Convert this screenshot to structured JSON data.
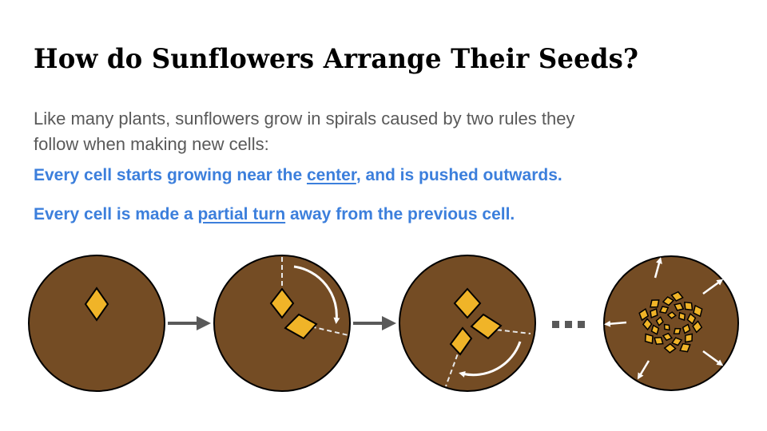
{
  "slide": {
    "title": "How do Sunflowers Arrange Their Seeds?",
    "intro": "Like many plants, sunflowers grow in spirals caused by two rules they follow when making new cells:",
    "rule1": {
      "before": "Every cell starts growing near the ",
      "emphasis": "center",
      "after": ", and is pushed outwards."
    },
    "rule2": {
      "before": "Every cell is made a ",
      "emphasis": "partial turn",
      "after": " away from the previous cell."
    }
  },
  "colors": {
    "title": "#000000",
    "intro_text": "#595959",
    "rule_text": "#3c7fdc",
    "flower_disk": "#744c24",
    "seed": "#f0b428",
    "arrow": "#595959",
    "white_annotation": "#ffffff"
  },
  "diagram": {
    "stages": [
      {
        "name": "stage-one-seed",
        "seed_count": 1
      },
      {
        "name": "stage-two-seeds",
        "seed_count": 2
      },
      {
        "name": "stage-three-seeds",
        "seed_count": 3
      },
      {
        "name": "stage-many-seeds",
        "seed_count": 26
      }
    ],
    "ellipsis": "...",
    "icons": [
      "right-arrow-icon",
      "rotation-arrow-icon",
      "outward-arrow-icon"
    ]
  }
}
